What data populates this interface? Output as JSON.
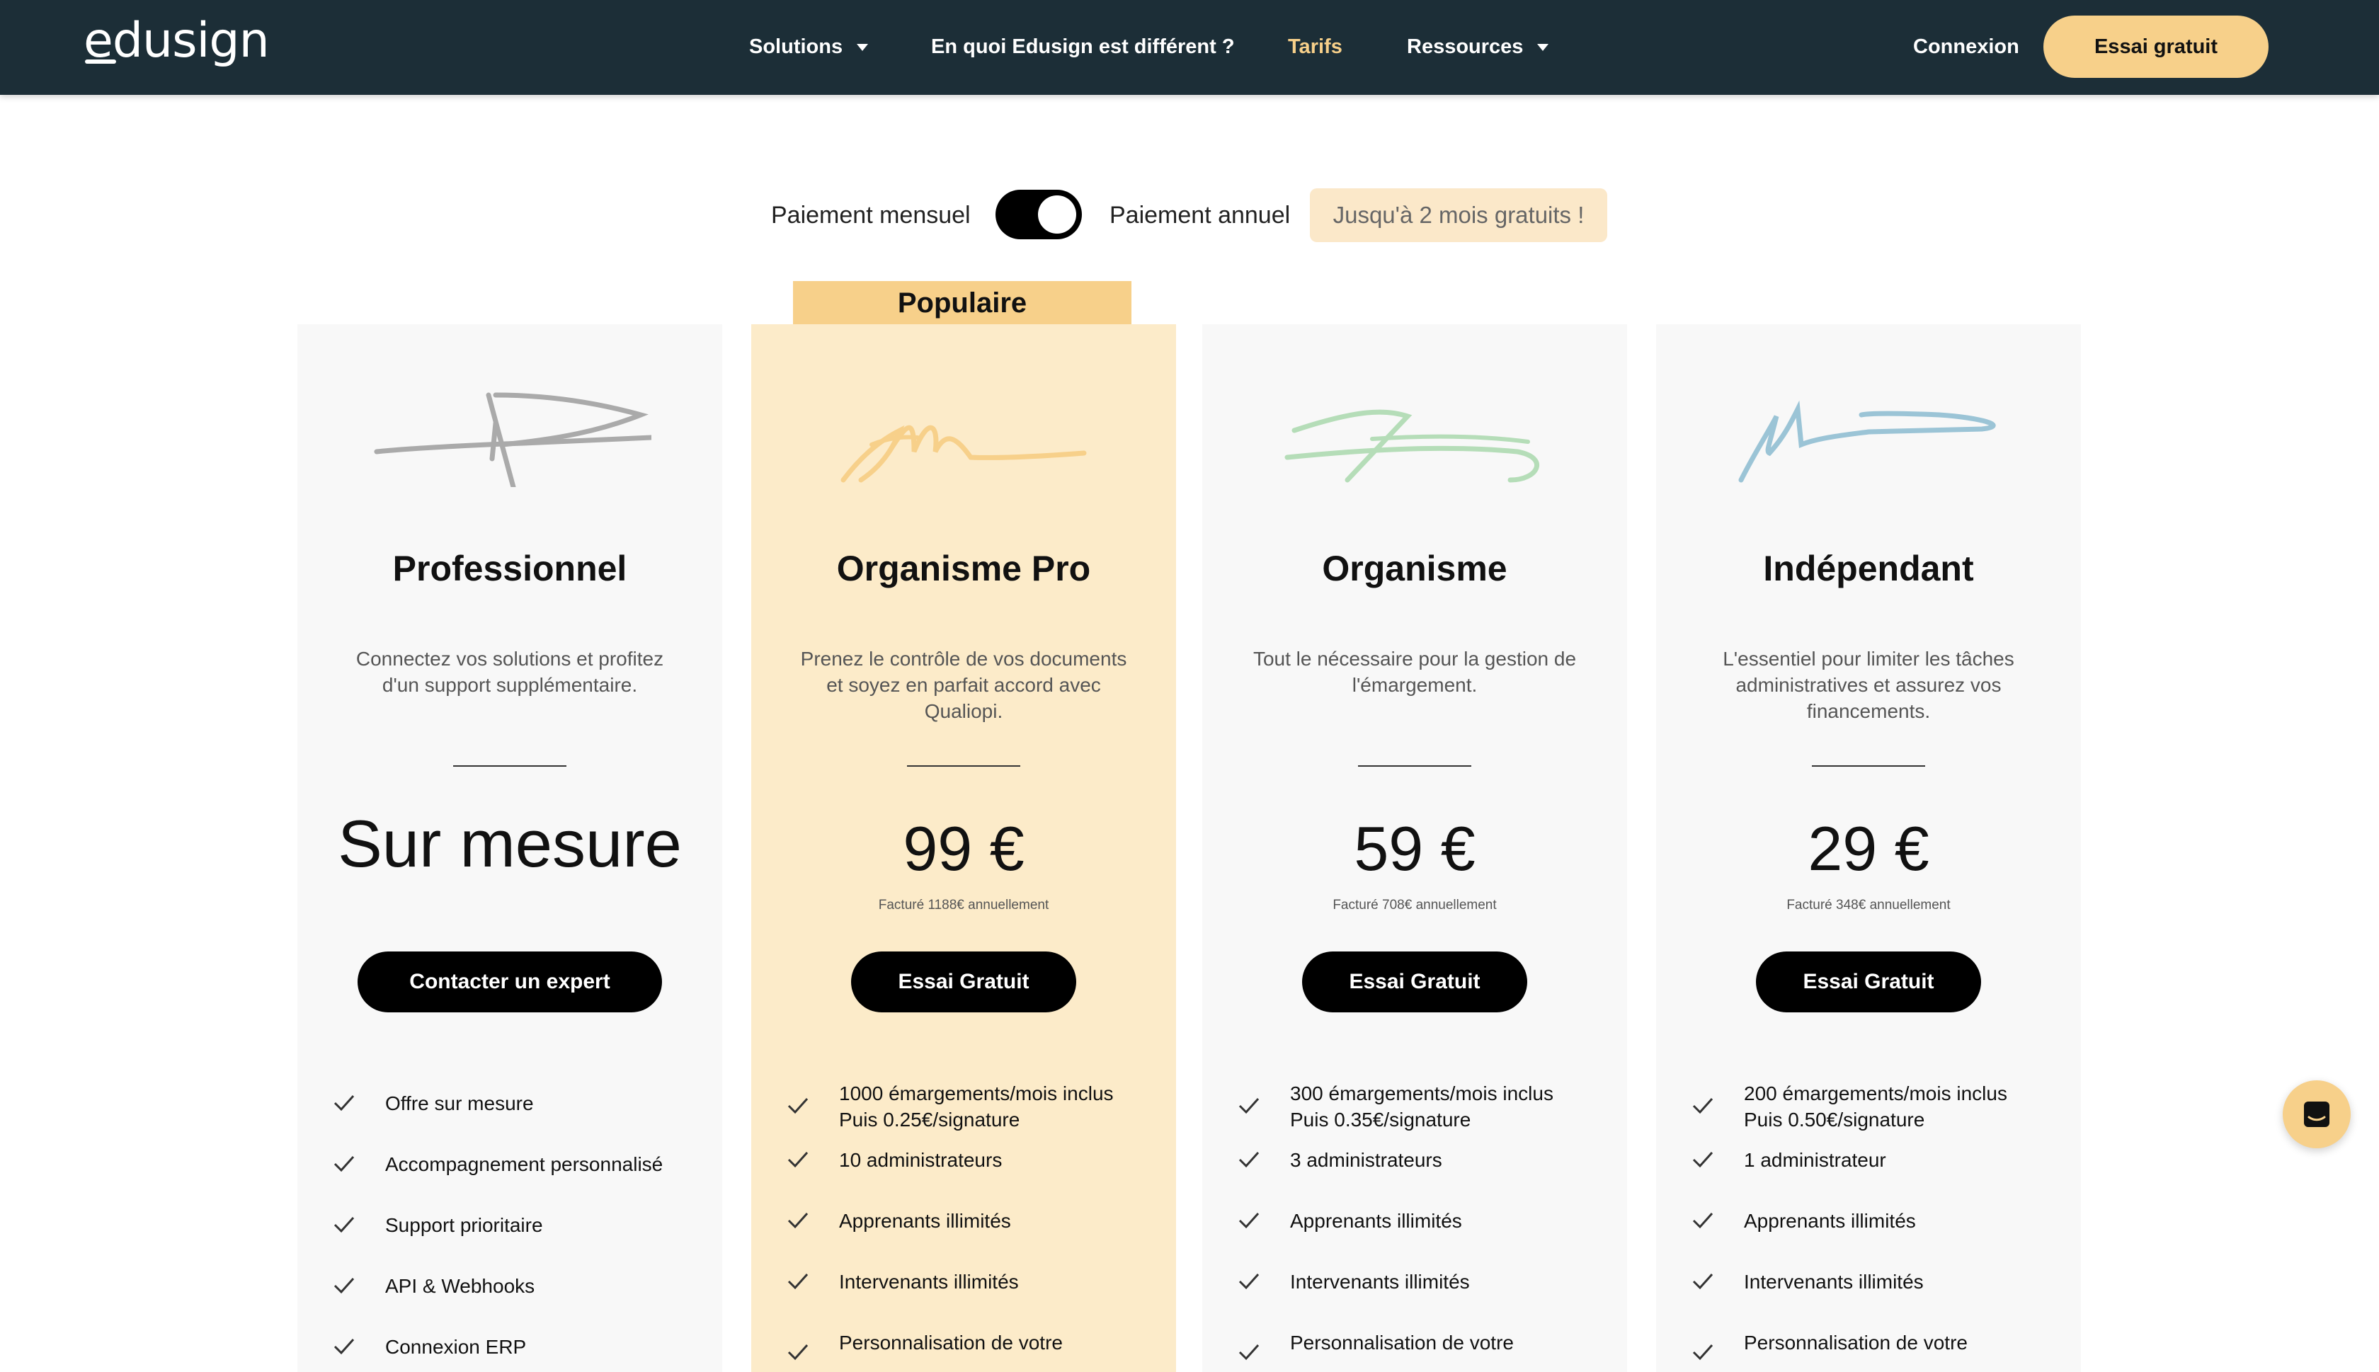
{
  "nav": {
    "logo": "edusign",
    "items": [
      "Solutions",
      "En quoi Edusign est différent ?",
      "Tarifs",
      "Ressources"
    ],
    "login": "Connexion",
    "cta": "Essai gratuit"
  },
  "billing": {
    "monthly": "Paiement mensuel",
    "annual": "Paiement annuel",
    "promo": "Jusqu'à 2 mois gratuits !",
    "toggle_state": "annual"
  },
  "popular_badge": "Populaire",
  "plans": [
    {
      "title": "Professionnel",
      "description": "Connectez vos solutions et profitez d'un support supplémentaire.",
      "price": "Sur mesure",
      "billed": "",
      "button": "Contacter un expert",
      "features": [
        "Offre sur mesure",
        "Accompagnement personnalisé",
        "Support prioritaire",
        "API & Webhooks",
        "Connexion ERP"
      ],
      "signature_color": "#aaaaaa"
    },
    {
      "title": "Organisme Pro",
      "description": "Prenez le contrôle de vos documents et soyez en parfait accord avec Qualiopi.",
      "price": "99 €",
      "billed": "Facturé 1188€ annuellement",
      "button": "Essai Gratuit",
      "features": [
        "1000 émargements/mois inclus",
        "Puis 0.25€/signature",
        "10 administrateurs",
        "Apprenants illimités",
        "Intervenants illimités",
        "Personnalisation de votre"
      ],
      "signature_color": "#f7d08a"
    },
    {
      "title": "Organisme",
      "description": "Tout le nécessaire pour la gestion de l'émargement.",
      "price": "59 €",
      "billed": "Facturé 708€ annuellement",
      "button": "Essai Gratuit",
      "features": [
        "300 émargements/mois inclus",
        "Puis 0.35€/signature",
        "3 administrateurs",
        "Apprenants illimités",
        "Intervenants illimités",
        "Personnalisation de votre"
      ],
      "signature_color": "#b5ddb8"
    },
    {
      "title": "Indépendant",
      "description": "L'essentiel pour limiter les tâches administratives et assurez vos financements.",
      "price": "29 €",
      "billed": "Facturé 348€ annuellement",
      "button": "Essai Gratuit",
      "features": [
        "200 émargements/mois inclus",
        "Puis 0.50€/signature",
        "1 administrateur",
        "Apprenants illimités",
        "Intervenants illimités",
        "Personnalisation de votre"
      ],
      "signature_color": "#9bc4d6"
    }
  ],
  "chat": {
    "icon": "chat-icon"
  },
  "colors": {
    "nav_bg": "#1c2e37",
    "accent": "#f7d08a",
    "popular_card": "#fcebc9"
  }
}
